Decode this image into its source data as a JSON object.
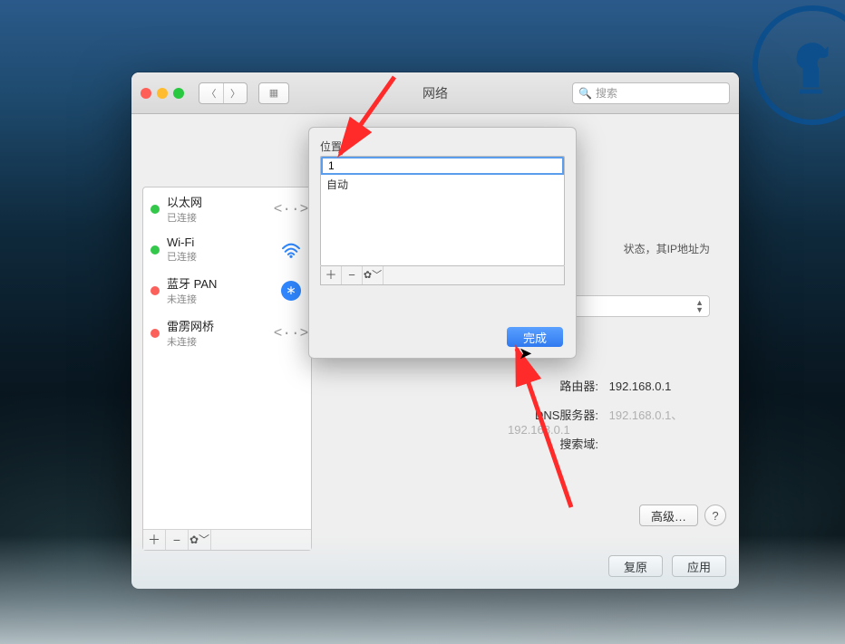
{
  "window": {
    "title": "网络",
    "search_placeholder": "搜索"
  },
  "location_bar": {
    "label": "位"
  },
  "sidebar": {
    "items": [
      {
        "name": "以太网",
        "sub": "已连接",
        "status": "green",
        "icon": "ethernet"
      },
      {
        "name": "Wi-Fi",
        "sub": "已连接",
        "status": "green",
        "icon": "wifi"
      },
      {
        "name": "蓝牙 PAN",
        "sub": "未连接",
        "status": "red",
        "icon": "bluetooth"
      },
      {
        "name": "雷雳网桥",
        "sub": "未连接",
        "status": "red",
        "icon": "thunderbolt"
      }
    ],
    "footer": {
      "add": "＋",
      "remove": "−",
      "gear": "✿﹀"
    }
  },
  "right": {
    "status_hint": "状态，其IP地址为",
    "router_label": "路由器:",
    "router_value": "192.168.0.1",
    "dns_label": "DNS服务器:",
    "dns_value": "192.168.0.1、192.168.0.1",
    "search_domain_label": "搜索域:",
    "advanced": "高级…",
    "help": "?",
    "revert": "复原",
    "apply": "应用"
  },
  "sheet": {
    "label": "位置",
    "editing_value": "1",
    "rows": [
      "自动"
    ],
    "footer": {
      "add": "＋",
      "remove": "−",
      "gear": "✿﹀"
    },
    "done": "完成"
  }
}
